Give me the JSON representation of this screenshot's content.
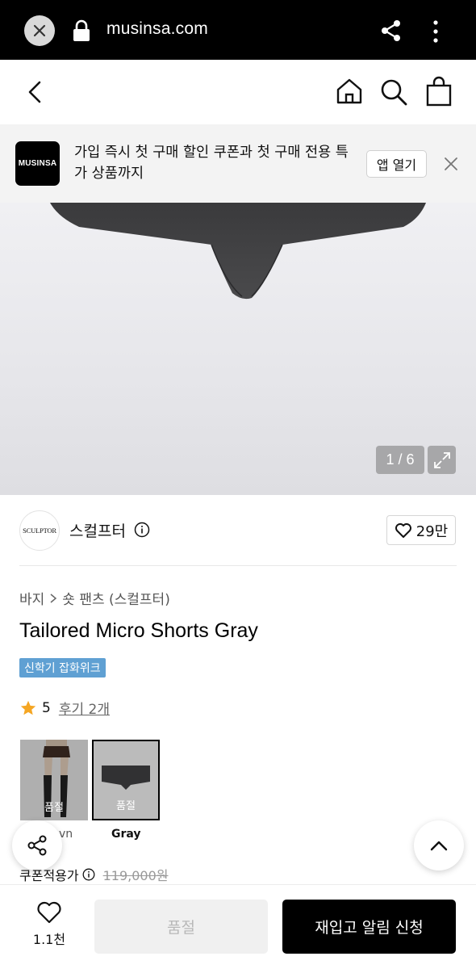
{
  "browser": {
    "url": "musinsa.com"
  },
  "promo": {
    "logo_text": "MUSINSA",
    "text": "가입 즉시 첫 구매 할인 쿠폰과 첫 구매 전용 특가 상품까지",
    "open_app_label": "앱 열기"
  },
  "gallery": {
    "counter": "1 / 6"
  },
  "brand": {
    "logo_text": "SCULPTOR",
    "name": "스컬프터",
    "likes": "29만"
  },
  "product": {
    "breadcrumb": [
      "바지",
      "숏 팬츠 (스컬프터)"
    ],
    "title": "Tailored Micro Shorts Gray",
    "tag": "신학기 잡화위크",
    "rating": "5",
    "reviews": "후기 2개"
  },
  "colors": [
    {
      "name": "Brown",
      "visible_name": "vn",
      "status": "품절",
      "selected": false
    },
    {
      "name": "Gray",
      "visible_name": "Gray",
      "status": "품절",
      "selected": true
    }
  ],
  "price": {
    "label": "쿠폰적용가",
    "original": "119,000원"
  },
  "bottom": {
    "likes": "1.1천",
    "soldout_label": "품절",
    "restock_label": "재입고 알림 신청"
  },
  "colors_theme": {
    "tag_bg": "#5fa0d3",
    "star": "#f5a623",
    "primary_button": "#000000"
  }
}
